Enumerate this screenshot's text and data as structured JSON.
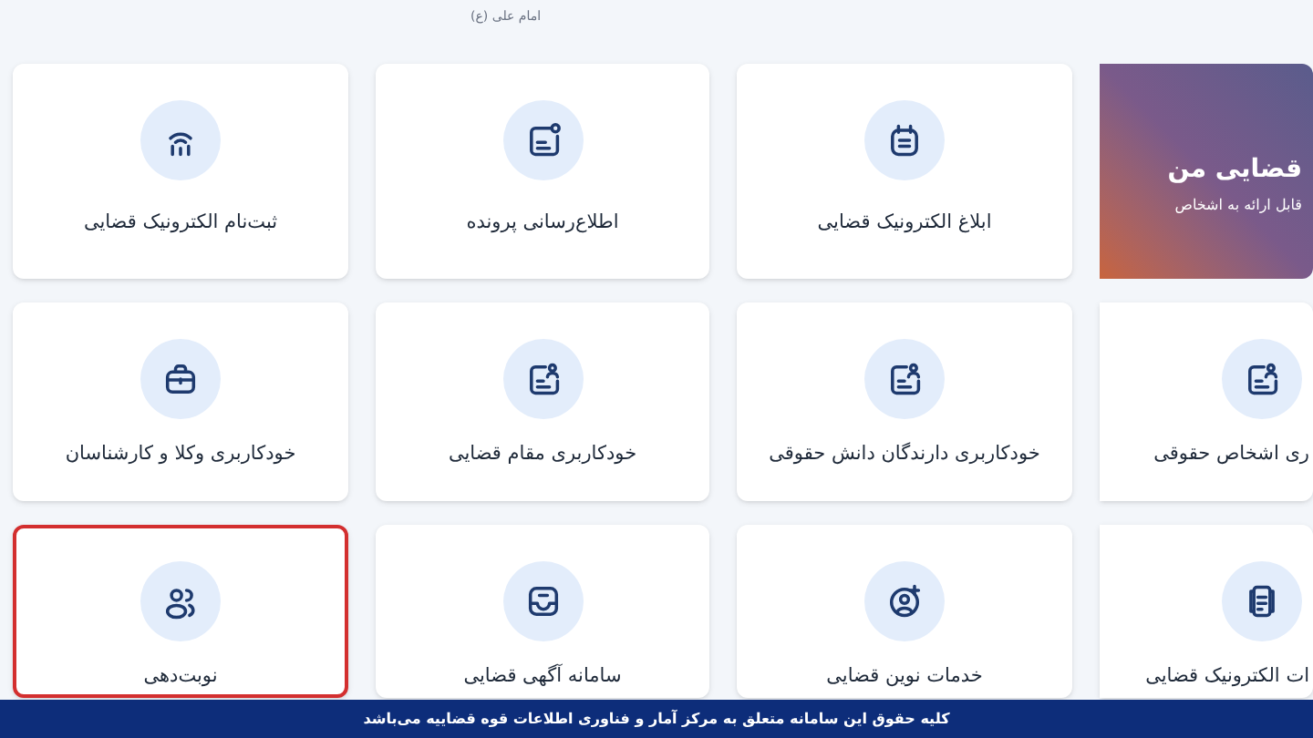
{
  "header": {
    "caption": "امام علی (ع)"
  },
  "banner": {
    "title": "قضایی من",
    "subtitle": "قابل ارائه به اشخاص"
  },
  "rows": [
    {
      "cards": [
        {
          "label": "ابلاغ الکترونیک قضایی",
          "selected": false
        },
        {
          "label": "اطلاع‌رسانی پرونده",
          "selected": false
        },
        {
          "label": "ثبت‌نام الکترونیک قضایی",
          "selected": false
        }
      ]
    },
    {
      "cards": [
        {
          "label": "ری اشخاص حقوقی",
          "selected": false
        },
        {
          "label": "خودکاربری دارندگان دانش حقوقی",
          "selected": false
        },
        {
          "label": "خودکاربری مقام قضایی",
          "selected": false
        },
        {
          "label": "خودکاربری وکلا و کارشناسان",
          "selected": false
        }
      ]
    },
    {
      "cards": [
        {
          "label": "ات الکترونیک قضایی",
          "selected": false
        },
        {
          "label": "خدمات نوین قضایی",
          "selected": false
        },
        {
          "label": "سامانه آگهی قضایی",
          "selected": false
        },
        {
          "label": "نوبت‌دهی",
          "selected": true
        }
      ]
    }
  ],
  "footer": {
    "text": "کلیه حقوق این سامانه متعلق به مرکز آمار و فناوری اطلاعات قوه قضاییه می‌باشد"
  }
}
